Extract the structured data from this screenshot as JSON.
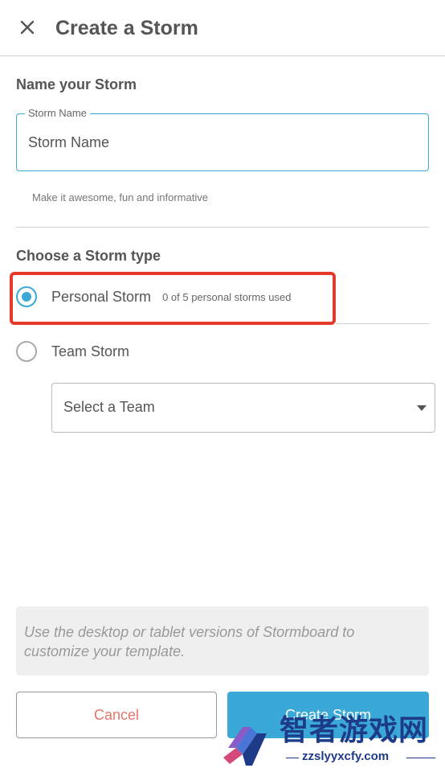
{
  "header": {
    "title": "Create a Storm",
    "close_icon": "close-icon"
  },
  "name_section": {
    "title": "Name your Storm",
    "field_label": "Storm Name",
    "field_value": "",
    "field_placeholder": "Storm Name",
    "hint": "Make it awesome, fun and informative"
  },
  "type_section": {
    "title": "Choose a Storm type",
    "options": [
      {
        "label": "Personal Storm",
        "sublabel": "0 of 5 personal storms used",
        "selected": true
      },
      {
        "label": "Team Storm",
        "sublabel": "",
        "selected": false
      }
    ],
    "team_select": {
      "value": "Select a Team"
    }
  },
  "info": {
    "text": "Use the desktop or tablet versions of Stormboard to customize your template."
  },
  "footer": {
    "cancel_label": "Cancel",
    "create_label": "Create Storm"
  },
  "watermark": {
    "title": "智者游戏网",
    "url": "zzslyyxcfy.com"
  },
  "colors": {
    "accent": "#3aa9d8",
    "highlight": "#e53a2a",
    "cancel_text": "#e8746a",
    "watermark": "#1e3b8a"
  }
}
